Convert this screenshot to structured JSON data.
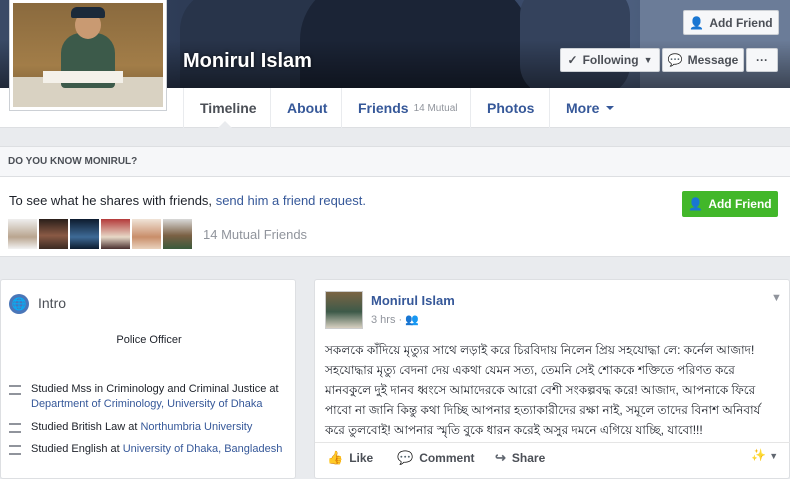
{
  "profile": {
    "name": "Monirul Islam"
  },
  "header_buttons": {
    "add_friend": "Add Friend",
    "following": "Following",
    "message": "Message",
    "more": "···"
  },
  "nav": {
    "timeline": "Timeline",
    "about": "About",
    "friends": "Friends",
    "friends_sub": "14 Mutual",
    "photos": "Photos",
    "more": "More"
  },
  "know_box": {
    "heading": "DO YOU KNOW MONIRUL?",
    "text": "To see what he shares with friends,",
    "link": "send him a friend request.",
    "add_friend": "Add Friend",
    "mutual": "14 Mutual Friends"
  },
  "intro": {
    "title": "Intro",
    "job": "Police Officer",
    "items": [
      {
        "text": "Studied Mss in Criminology and Criminal Justice at ",
        "link": "Department of Criminology, University of Dhaka"
      },
      {
        "text": "Studied British Law at ",
        "link": "Northumbria University"
      },
      {
        "text": "Studied English at ",
        "link": "University of Dhaka, Bangladesh"
      }
    ]
  },
  "post": {
    "author": "Monirul Islam",
    "time": "3 hrs",
    "privacy_icon": "friends-icon",
    "body": "সকলকে কাঁদিয়ে মৃত্যুর সাথে লড়াই করে চিরবিদায় নিলেন প্রিয় সহযোদ্ধা লে: কর্নেল আজাদ! সহযোদ্ধার মৃত্যু বেদনা দেয় একথা যেমন সত্য, তেমনি সেই শোককে শক্তিতে পরিণত করে মানবকুলে দুই দানব ধ্বংসে আমাদেরকে আরো বেশী সংকল্পবদ্ধ করে! আজাদ, আপনাকে ফিরে পাবো না জানি কিন্তু কথা দিচ্ছি আপনার হত্যাকারীদের রক্ষা নাই, সমূলে তাদের বিনাশ অনিবার্য করে তুলবোই! আপনার স্মৃতি বুকে ধারন করেই অসুর দমনে এগিয়ে যাচ্ছি, যাবো!!!",
    "actions": {
      "like": "Like",
      "comment": "Comment",
      "share": "Share"
    }
  },
  "colors": {
    "link": "#365899",
    "green": "#42b72a",
    "bg": "#e9ebee"
  }
}
